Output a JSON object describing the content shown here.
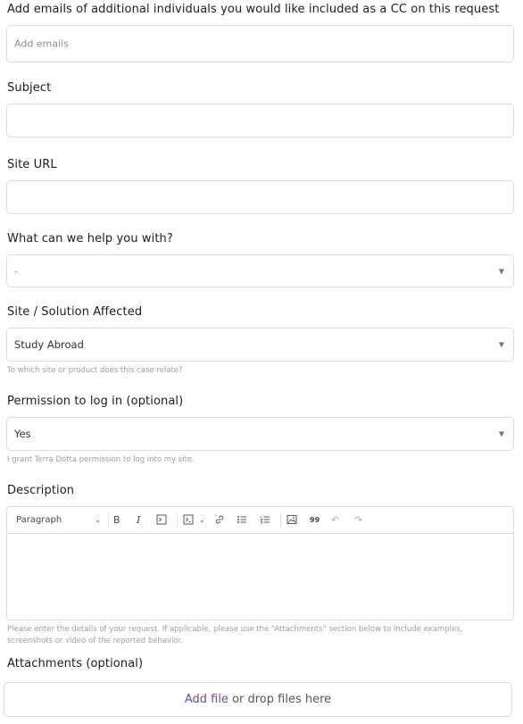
{
  "cc": {
    "label": "Add emails of additional individuals you would like included as a CC on this request",
    "placeholder": "Add emails"
  },
  "subject": {
    "label": "Subject",
    "value": ""
  },
  "site_url": {
    "label": "Site URL",
    "value": ""
  },
  "help": {
    "label": "What can we help you with?",
    "value": "-"
  },
  "site_solution": {
    "label": "Site / Solution Affected",
    "value": "Study Abroad",
    "hint": "To which site or product does this case relate?"
  },
  "permission": {
    "label": "Permission to log in (optional)",
    "value": "Yes",
    "hint": "I grant Terra Dotta permission to log into my site."
  },
  "description": {
    "label": "Description",
    "block_style": "Paragraph",
    "hint_line1": "Please enter the details of your request. If applicable, please use the “Attachments” section below to include examples,",
    "hint_line2": "screenshots or video of the reported behavior."
  },
  "attachments": {
    "label": "Attachments (optional)",
    "add_file": "Add file",
    "drop_text": " or drop files here"
  },
  "icons": {
    "bold": "B",
    "italic": "I",
    "quote": "99"
  }
}
